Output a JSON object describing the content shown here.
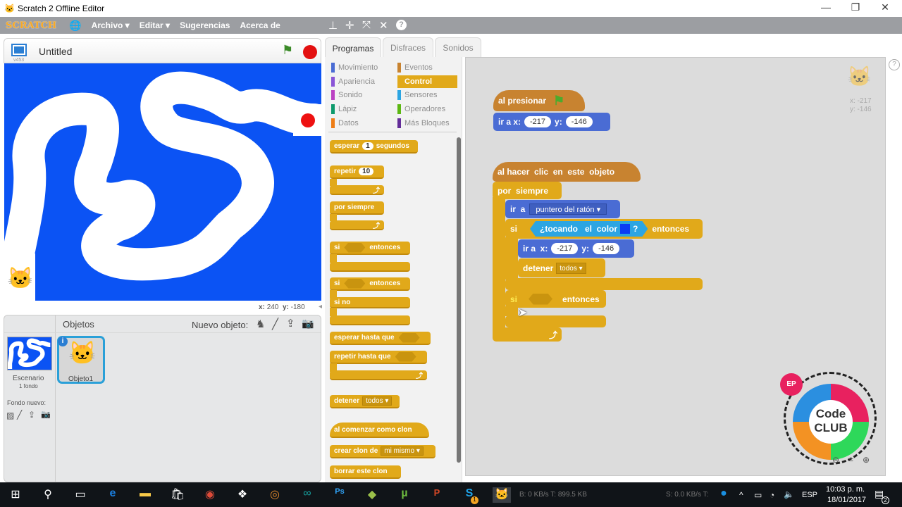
{
  "window": {
    "title": "Scratch 2 Offline Editor",
    "controls": {
      "minimize": "—",
      "restore": "❐",
      "close": "✕"
    }
  },
  "menubar": {
    "logo": "SCRATCH",
    "items": [
      "Archivo ▾",
      "Editar ▾",
      "Sugerencias",
      "Acerca de"
    ],
    "tools": [
      "stamp-icon",
      "grow-icon",
      "expand-icon",
      "shrink-icon",
      "help-icon"
    ]
  },
  "stage": {
    "project_title": "Untitled",
    "version": "v453",
    "mouse_x_label": "x:",
    "mouse_x": "240",
    "mouse_y_label": "y:",
    "mouse_y": "-180",
    "colors": {
      "background": "#0b53f4",
      "path": "#ffffff",
      "goal": "#ee1111"
    }
  },
  "sprites": {
    "header": "Objetos",
    "new_sprite_label": "Nuevo objeto:",
    "stage_label": "Escenario",
    "stage_backdrops": "1 fondo",
    "new_backdrop_label": "Fondo nuevo:",
    "items": [
      {
        "name": "Objeto1",
        "selected": true
      }
    ]
  },
  "tabs": [
    {
      "label": "Programas",
      "active": true
    },
    {
      "label": "Disfraces",
      "active": false
    },
    {
      "label": "Sonidos",
      "active": false
    }
  ],
  "categories": [
    {
      "label": "Movimiento",
      "color": "#4a6cd4"
    },
    {
      "label": "Apariencia",
      "color": "#8a55d7"
    },
    {
      "label": "Sonido",
      "color": "#bb42c3"
    },
    {
      "label": "Lápiz",
      "color": "#0e9a6c"
    },
    {
      "label": "Datos",
      "color": "#ee7d16"
    },
    {
      "label": "Eventos",
      "color": "#c88330"
    },
    {
      "label": "Control",
      "color": "#e1a91a",
      "active": true
    },
    {
      "label": "Sensores",
      "color": "#2ca5e2"
    },
    {
      "label": "Operadores",
      "color": "#5cb712"
    },
    {
      "label": "Más Bloques",
      "color": "#632d99"
    }
  ],
  "palette": {
    "wait": {
      "a": "esperar",
      "v": "1",
      "b": "segundos"
    },
    "repeat": {
      "a": "repetir",
      "v": "10"
    },
    "forever": "por siempre",
    "if": {
      "a": "si",
      "b": "entonces"
    },
    "ifelse": {
      "a": "si",
      "b": "entonces",
      "else": "si no"
    },
    "wait_until": "esperar hasta que",
    "repeat_until": "repetir hasta que",
    "stop": {
      "a": "detener",
      "v": "todos ▾"
    },
    "clone_start": "al comenzar como clon",
    "create_clone": {
      "a": "crear clon de",
      "v": "mi mismo ▾"
    },
    "delete_clone": "borrar este clon"
  },
  "scripts": {
    "script1": {
      "hat": "al presionar",
      "goto_label": "ir a x:",
      "x": "-217",
      "y_label": "y:",
      "y": "-146"
    },
    "script2": {
      "hat": "al hacer  clic  en  este  objeto",
      "forever": "por  siempre",
      "goto_label": "ir  a",
      "goto_target": "puntero del ratón ▾",
      "if_label": "si",
      "touching": "¿tocando   el  color",
      "touching_q": "?",
      "then": "entonces",
      "goto_xy_label": "ir a  x:",
      "x": "-217",
      "y_label": "y:",
      "y": "-146",
      "stop_label": "detener",
      "stop_value": "todos ▾",
      "if2_label": "si",
      "then2": "entonces"
    }
  },
  "sprite_info": {
    "x": "x: -217",
    "y": "y: -146"
  },
  "zoom_controls": [
    "zoom-out",
    "zoom-reset",
    "zoom-in"
  ],
  "taskbar": {
    "apps": [
      "start",
      "search",
      "task-view",
      "edge",
      "file-explorer",
      "store",
      "chrome",
      "dropbox",
      "app",
      "arduino",
      "photoshop",
      "app2",
      "utorrent",
      "powerpoint",
      "skype",
      "scratch"
    ],
    "net1": "B: 0 KB/s T: 899.5 KB",
    "net2": "S: 0.0 KB/s T:",
    "lang": "ESP",
    "time": "10:03 p. m.",
    "date": "18/01/2017",
    "notifications": "2",
    "skype_badge": "1"
  }
}
